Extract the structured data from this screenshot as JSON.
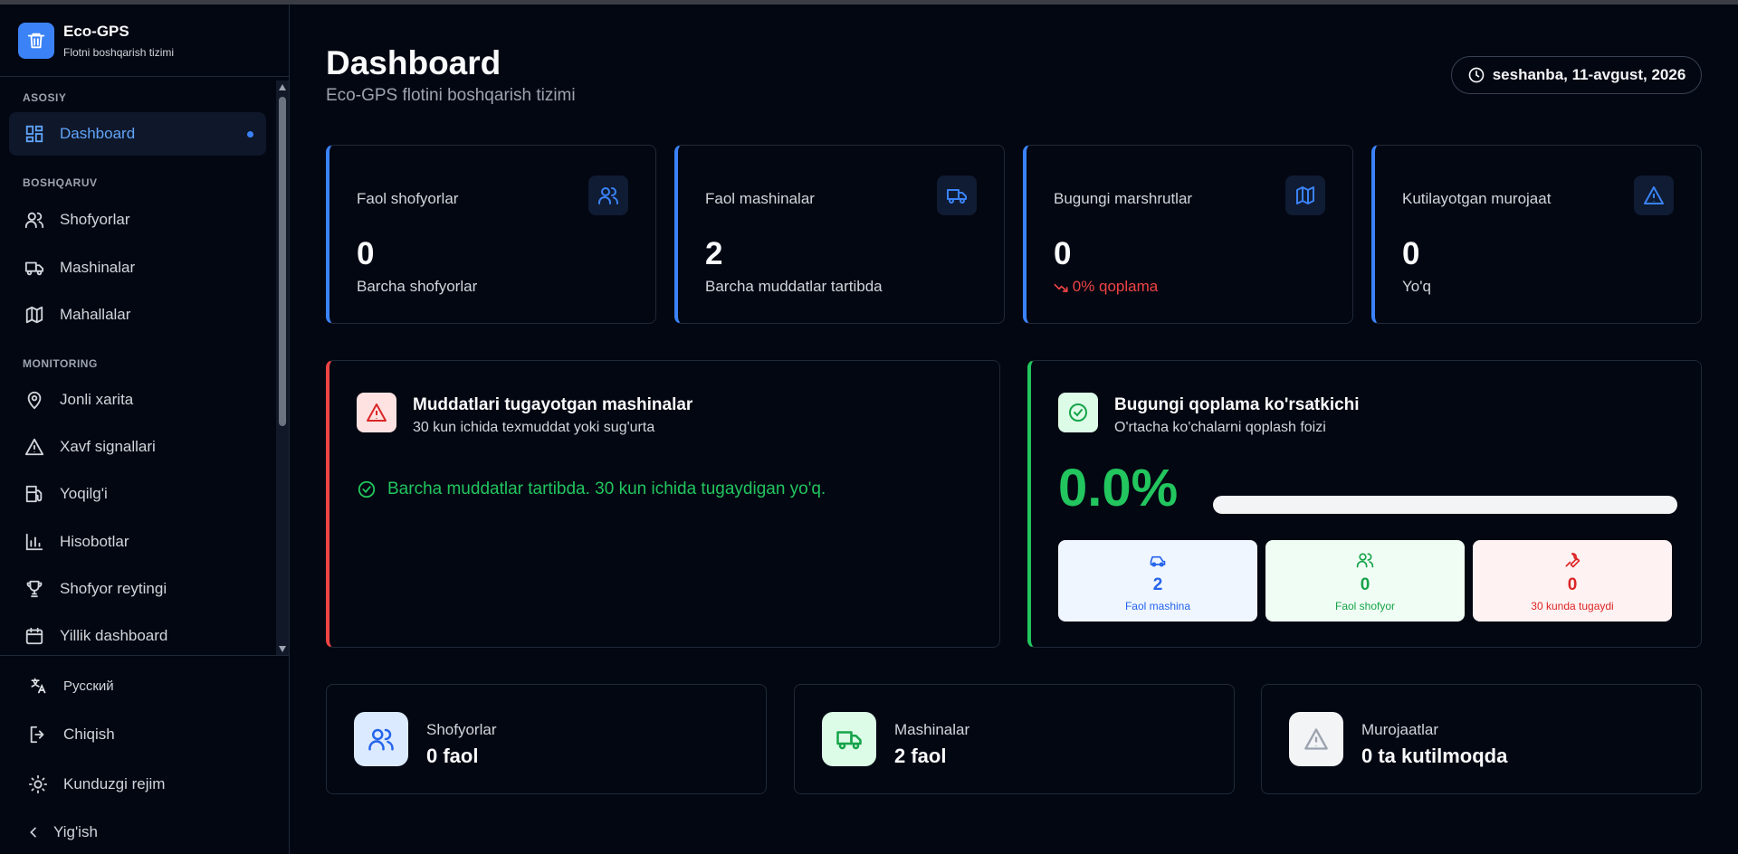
{
  "brand": {
    "title": "Eco-GPS",
    "subtitle": "Flotni boshqarish tizimi"
  },
  "sidebar": {
    "sections": [
      {
        "label": "ASOSIY"
      },
      {
        "label": "BOSHQARUV"
      },
      {
        "label": "MONITORING"
      }
    ],
    "items": [
      {
        "label": "Dashboard",
        "icon": "dashboard-icon",
        "active": true
      },
      {
        "label": "Shofyorlar",
        "icon": "users-icon"
      },
      {
        "label": "Mashinalar",
        "icon": "truck-icon"
      },
      {
        "label": "Mahallalar",
        "icon": "map-icon"
      },
      {
        "label": "Jonli xarita",
        "icon": "map-pin-icon"
      },
      {
        "label": "Xavf signallari",
        "icon": "alert-triangle-icon"
      },
      {
        "label": "Yoqilg'i",
        "icon": "fuel-icon"
      },
      {
        "label": "Hisobotlar",
        "icon": "bar-chart-icon"
      },
      {
        "label": "Shofyor reytingi",
        "icon": "trophy-icon"
      },
      {
        "label": "Yillik dashboard",
        "icon": "calendar-icon"
      }
    ],
    "bottom": {
      "language": "Русский",
      "logout": "Chiqish",
      "theme": "Kunduzgi rejim",
      "collapse": "Yig'ish"
    }
  },
  "header": {
    "title": "Dashboard",
    "subtitle": "Eco-GPS flotini boshqarish tizimi",
    "date": "seshanba, 11-avgust, 2026"
  },
  "stats": [
    {
      "label": "Faol shofyorlar",
      "value": "0",
      "foot": "Barcha shofyorlar",
      "icon": "users-icon"
    },
    {
      "label": "Faol mashinalar",
      "value": "2",
      "foot": "Barcha muddatlar tartibda",
      "icon": "truck-icon"
    },
    {
      "label": "Bugungi marshrutlar",
      "value": "0",
      "foot": "0% qoplama",
      "icon": "map-icon"
    },
    {
      "label": "Kutilayotgan murojaat",
      "value": "0",
      "foot": "Yo'q",
      "icon": "alert-triangle-icon"
    }
  ],
  "expiry_panel": {
    "title": "Muddatlari tugayotgan mashinalar",
    "subtitle": "30 kun ichida texmuddat yoki sug'urta",
    "message": "Barcha muddatlar tartibda. 30 kun ichida tugaydigan yo'q."
  },
  "coverage_panel": {
    "title": "Bugungi qoplama ko'rsatkichi",
    "subtitle": "O'rtacha ko'chalarni qoplash foizi",
    "percent_text": "0.0%",
    "progress": 0,
    "minis": [
      {
        "value": "2",
        "label": "Faol mashina",
        "icon": "car-icon"
      },
      {
        "value": "0",
        "label": "Faol shofyor",
        "icon": "users-icon"
      },
      {
        "value": "0",
        "label": "30 kunda tugaydi",
        "icon": "wrench-icon"
      }
    ]
  },
  "summary": [
    {
      "label": "Shofyorlar",
      "value": "0 faol",
      "icon": "users-icon"
    },
    {
      "label": "Mashinalar",
      "value": "2 faol",
      "icon": "truck-icon"
    },
    {
      "label": "Murojaatlar",
      "value": "0 ta kutilmoqda",
      "icon": "alert-triangle-icon"
    }
  ],
  "colors": {
    "accent": "#3b82f6",
    "danger": "#ef4444",
    "success": "#22c55e",
    "background": "#030712"
  }
}
